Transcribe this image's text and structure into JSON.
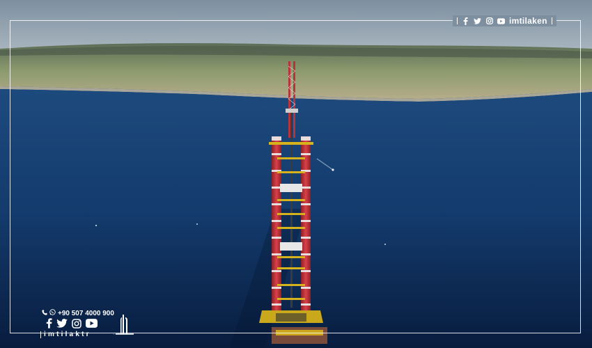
{
  "brand": {
    "handle": "imtilaken",
    "phone": "+90 507 4000 900",
    "footer_name": "imtilaktr",
    "icons": [
      "facebook-icon",
      "twitter-icon",
      "instagram-icon",
      "youtube-icon"
    ]
  },
  "colors": {
    "sea_top": "#1b4679",
    "sea_bottom": "#0a2147",
    "tower_red": "#c8323a",
    "tower_white": "#e8e8e8",
    "scaffold_yellow": "#d6b31c"
  }
}
